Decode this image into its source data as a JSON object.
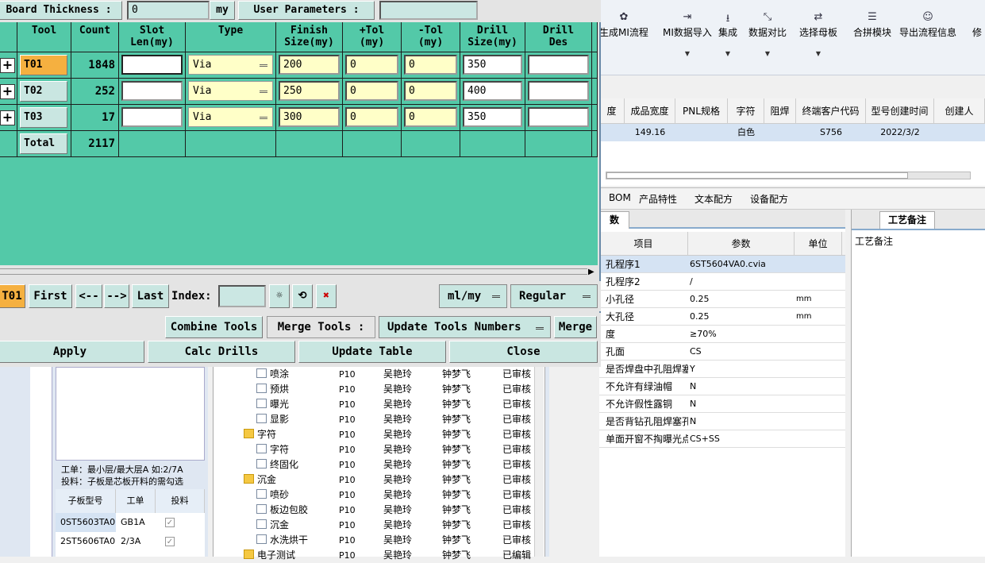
{
  "dialog": {
    "board_thickness_label": "Board Thickness :",
    "board_thickness_value": "0",
    "board_thickness_unit": "my",
    "user_params_label": "User Parameters :",
    "user_params_value": "",
    "columns": [
      "Tool",
      "Count",
      "Slot\nLen(my)",
      "Type",
      "Finish\nSize(my)",
      "+Tol\n(my)",
      "-Tol\n(my)",
      "Drill\nSize(my)",
      "Drill\nDes"
    ],
    "rows": [
      {
        "tool": "T01",
        "count": "1848",
        "slot": "",
        "type": "Via",
        "finish": "200",
        "ptol": "0",
        "mtol": "0",
        "drill": "350",
        "des": ""
      },
      {
        "tool": "T02",
        "count": "252",
        "slot": "",
        "type": "Via",
        "finish": "250",
        "ptol": "0",
        "mtol": "0",
        "drill": "400",
        "des": ""
      },
      {
        "tool": "T03",
        "count": "17",
        "slot": "",
        "type": "Via",
        "finish": "300",
        "ptol": "0",
        "mtol": "0",
        "drill": "350",
        "des": ""
      }
    ],
    "total_label": "Total",
    "total_count": "2117",
    "nav": {
      "current": "T01",
      "first": "First",
      "prev": "<--",
      "next": "-->",
      "last": "Last",
      "index_label": "Index:",
      "index_value": "",
      "units": "ml/my",
      "mode": "Regular"
    },
    "buttons": {
      "combine": "Combine Tools",
      "merge_label": "Merge Tools :",
      "update_numbers": "Update Tools Numbers",
      "merge": "Merge",
      "apply": "Apply",
      "calc": "Calc Drills",
      "update_table": "Update Table",
      "close": "Close"
    }
  },
  "toolbar": [
    {
      "icon": "gear-icon",
      "label": "生成MI流程"
    },
    {
      "icon": "import-icon",
      "label": "MI数据导入"
    },
    {
      "icon": "download-icon",
      "label": "集成"
    },
    {
      "icon": "compare-icon",
      "label": "数据对比"
    },
    {
      "icon": "shuffle-icon",
      "label": "选择母板"
    },
    {
      "icon": "list-icon",
      "label": "合拼模块"
    },
    {
      "icon": "smile-icon",
      "label": "导出流程信息"
    },
    {
      "icon": "",
      "label": "修"
    }
  ],
  "grid": {
    "headers": [
      "度",
      "成品宽度",
      "PNL规格",
      "字符",
      "阻焊",
      "终端客户代码",
      "型号创建时间",
      "创建人"
    ],
    "row": [
      "",
      "149.16",
      "",
      "白色",
      "",
      "S756",
      "2022/3/2",
      ""
    ]
  },
  "tabs2": [
    "BOM",
    "产品特性",
    "文本配方",
    "设备配方"
  ],
  "params": {
    "tab": "数",
    "headers": [
      "项目",
      "参数",
      "单位"
    ],
    "rows": [
      {
        "item": "孔程序1",
        "value": "6ST5604VA0.cvia",
        "unit": ""
      },
      {
        "item": "孔程序2",
        "value": "/",
        "unit": ""
      },
      {
        "item": "小孔径",
        "value": "0.25",
        "unit": "mm"
      },
      {
        "item": "大孔径",
        "value": "0.25",
        "unit": "mm"
      },
      {
        "item": "度",
        "value": "≥70%",
        "unit": ""
      },
      {
        "item": "孔面",
        "value": "CS",
        "unit": ""
      },
      {
        "item": "是否焊盘中孔阻焊塞孔",
        "value": "Y",
        "unit": ""
      },
      {
        "item": "不允许有绿油帽",
        "value": "N",
        "unit": ""
      },
      {
        "item": "不允许假性露铜",
        "value": "N",
        "unit": ""
      },
      {
        "item": "是否背钻孔阻焊塞孔制作",
        "value": "N",
        "unit": ""
      },
      {
        "item": "单面开窗不掏曝光点",
        "value": "CS+SS",
        "unit": ""
      }
    ]
  },
  "memo": {
    "tab": "工艺备注",
    "label": "工艺备注"
  },
  "left_note": [
    "工单：最小层/最大层A 如:2/7A",
    "投料：子板是芯板开料的需勾选"
  ],
  "subtable": {
    "headers": [
      "子板型号",
      "工单",
      "投料"
    ],
    "rows": [
      [
        "0ST5603TA0",
        "GB1A"
      ],
      [
        "2ST5606TA0",
        "2/3A"
      ]
    ]
  },
  "tree": [
    {
      "name": "喷涂",
      "folder": false,
      "p": "P10",
      "a": "吴艳玲",
      "b": "钟梦飞",
      "s": "已审核"
    },
    {
      "name": "预烘",
      "folder": false,
      "p": "P10",
      "a": "吴艳玲",
      "b": "钟梦飞",
      "s": "已审核"
    },
    {
      "name": "曝光",
      "folder": false,
      "p": "P10",
      "a": "吴艳玲",
      "b": "钟梦飞",
      "s": "已审核"
    },
    {
      "name": "显影",
      "folder": false,
      "p": "P10",
      "a": "吴艳玲",
      "b": "钟梦飞",
      "s": "已审核"
    },
    {
      "name": "字符",
      "folder": true,
      "p": "P10",
      "a": "吴艳玲",
      "b": "钟梦飞",
      "s": "已审核"
    },
    {
      "name": "字符",
      "folder": false,
      "p": "P10",
      "a": "吴艳玲",
      "b": "钟梦飞",
      "s": "已审核"
    },
    {
      "name": "终固化",
      "folder": false,
      "p": "P10",
      "a": "吴艳玲",
      "b": "钟梦飞",
      "s": "已审核"
    },
    {
      "name": "沉金",
      "folder": true,
      "p": "P10",
      "a": "吴艳玲",
      "b": "钟梦飞",
      "s": "已审核"
    },
    {
      "name": "喷砂",
      "folder": false,
      "p": "P10",
      "a": "吴艳玲",
      "b": "钟梦飞",
      "s": "已审核"
    },
    {
      "name": "板边包胶",
      "folder": false,
      "p": "P10",
      "a": "吴艳玲",
      "b": "钟梦飞",
      "s": "已审核"
    },
    {
      "name": "沉金",
      "folder": false,
      "p": "P10",
      "a": "吴艳玲",
      "b": "钟梦飞",
      "s": "已审核"
    },
    {
      "name": "水洗烘干",
      "folder": false,
      "p": "P10",
      "a": "吴艳玲",
      "b": "钟梦飞",
      "s": "已审核"
    },
    {
      "name": "电子测试",
      "folder": true,
      "p": "P10",
      "a": "吴艳玲",
      "b": "钟梦飞",
      "s": "已编辑"
    }
  ]
}
